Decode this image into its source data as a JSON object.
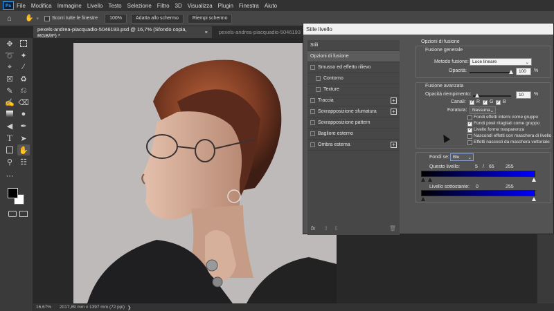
{
  "app": {
    "logo": "Ps",
    "menu": [
      "File",
      "Modifica",
      "Immagine",
      "Livello",
      "Testo",
      "Selezione",
      "Filtro",
      "3D",
      "Visualizza",
      "Plugin",
      "Finestra",
      "Aiuto"
    ]
  },
  "options": {
    "scroll_all_label": "Scorri tutte le finestre",
    "zoom_value": "100%",
    "fit_screen": "Adatta allo schermo",
    "fill_screen": "Riempi schermo"
  },
  "tabs": [
    {
      "label": "pexels-andrea-piacquadio-5046193.psd @ 16,7% (Sfondo copia, RGB/8*) *"
    },
    {
      "label": "pexels-andrea-piacquadio-5046193"
    }
  ],
  "status": {
    "zoom": "16,67%",
    "doc_size": "2017,89 mm x 1397 mm (72 ppi)"
  },
  "dialog": {
    "title": "Stile livello",
    "styles_header": "Stili",
    "styles": [
      {
        "label": "Opzioni di fusione",
        "checkbox": false,
        "plus": false,
        "active": true
      },
      {
        "label": "Smusso ed effetto rilievo",
        "checkbox": true,
        "plus": false
      },
      {
        "label": "Contorno",
        "checkbox": true,
        "plus": false,
        "indent": true
      },
      {
        "label": "Texture",
        "checkbox": true,
        "plus": false,
        "indent": true
      },
      {
        "label": "Traccia",
        "checkbox": true,
        "plus": true
      },
      {
        "label": "Sovrapposizione sfumatura",
        "checkbox": true,
        "plus": true
      },
      {
        "label": "Sovrapposizione pattern",
        "checkbox": true,
        "plus": false
      },
      {
        "label": "Bagliore esterno",
        "checkbox": true,
        "plus": false
      },
      {
        "label": "Ombra esterna",
        "checkbox": true,
        "plus": true
      }
    ],
    "footer_icons": [
      "fx-icon",
      "arrow-up-icon",
      "arrow-down-icon",
      "trash-icon"
    ],
    "section_title": "Opzioni di fusione",
    "general": {
      "title": "Fusione generale",
      "blend_label": "Metodo fusione:",
      "blend_value": "Luce lineare",
      "opacity_label": "Opacità:",
      "opacity_value": "100",
      "opacity_unit": "%",
      "opacity_fraction": 1.0
    },
    "advanced": {
      "title": "Fusione avanzata",
      "fill_label": "Opacità riempimento:",
      "fill_value": "10",
      "fill_unit": "%",
      "fill_fraction": 0.1,
      "channels_label": "Canali:",
      "channels": [
        {
          "name": "R",
          "checked": true
        },
        {
          "name": "G",
          "checked": true
        },
        {
          "name": "B",
          "checked": true
        }
      ],
      "knockout_label": "Foratura:",
      "knockout_value": "Nessuna",
      "options": [
        {
          "label": "Fondi effetti interni come gruppo",
          "checked": false
        },
        {
          "label": "Fondi pixel ritagliati come gruppo",
          "checked": true
        },
        {
          "label": "Livello forme trasparenza",
          "checked": true
        },
        {
          "label": "Nascondi effetti con maschera di livello",
          "checked": false
        },
        {
          "label": "Effetti nascosti da maschera vettoriale",
          "checked": false
        }
      ]
    },
    "blendif": {
      "label": "Fondi se:",
      "channel": "Blu",
      "this_layer_label": "Questo livello:",
      "this_layer_low": "5",
      "this_layer_sep": "/",
      "this_layer_mid": "65",
      "this_layer_high": "255",
      "underlying_label": "Livello sottostante:",
      "underlying_low": "0",
      "underlying_high": "255",
      "gradient_color": "#0000ff"
    }
  }
}
